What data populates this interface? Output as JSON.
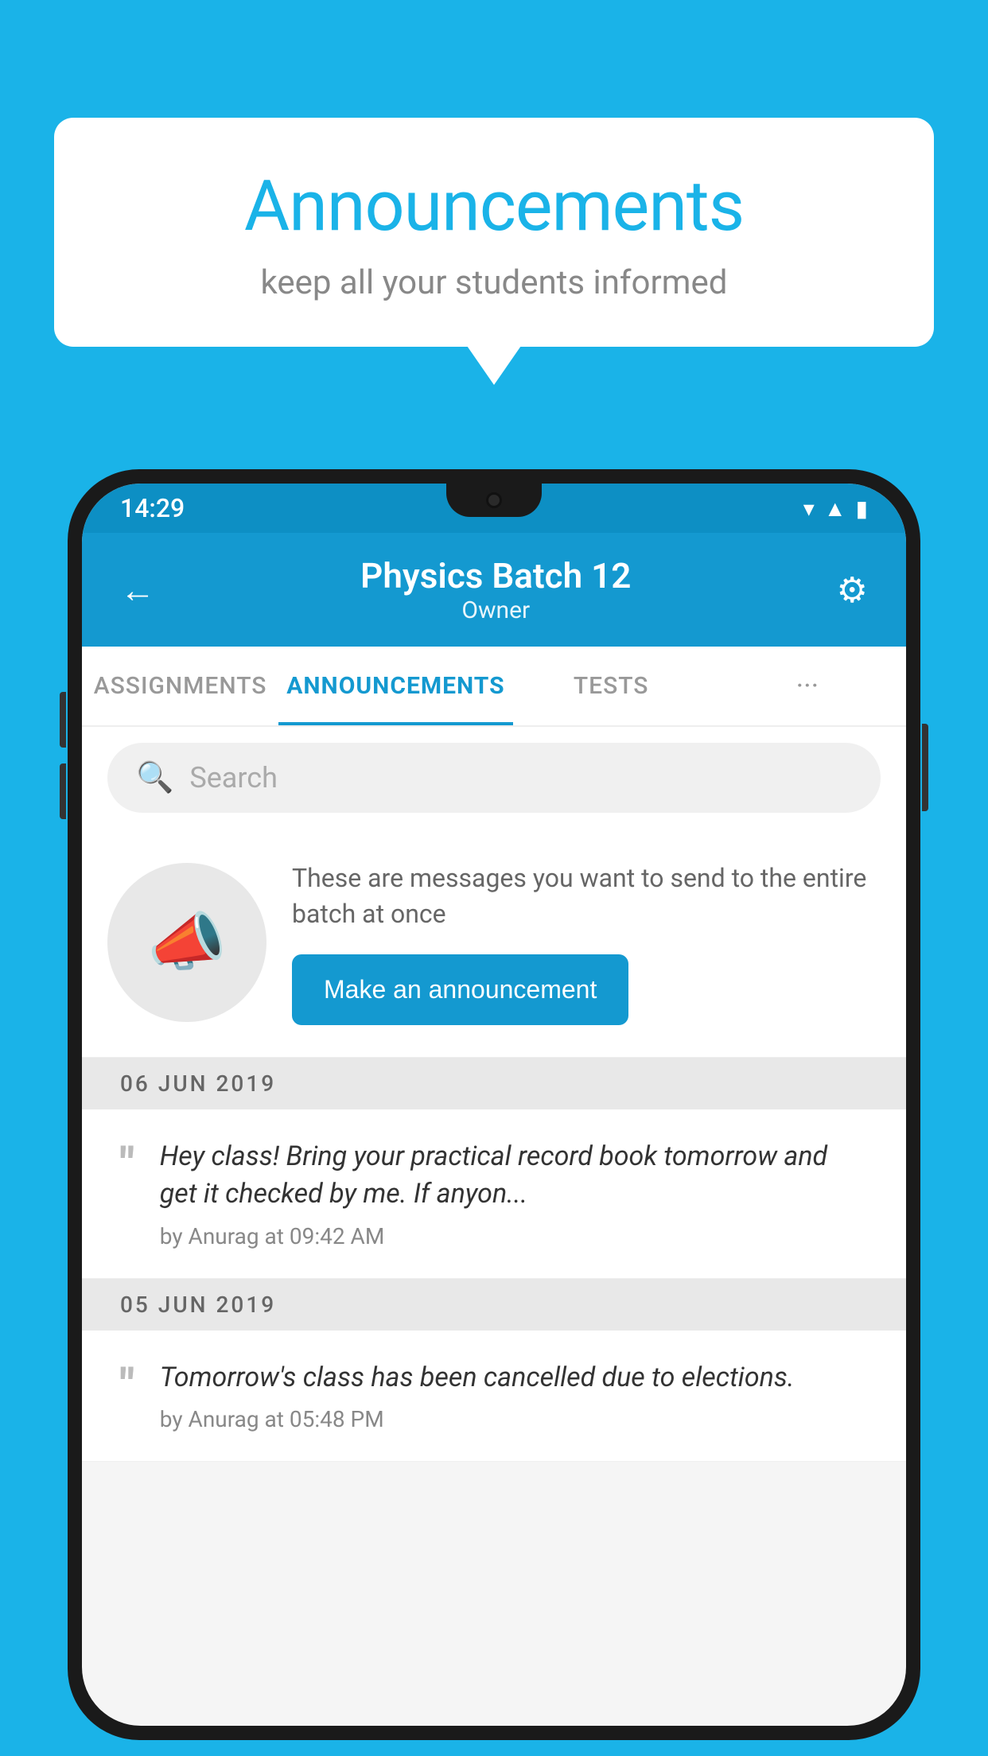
{
  "page": {
    "background_color": "#1ab3e8"
  },
  "speech_bubble": {
    "title": "Announcements",
    "subtitle": "keep all your students informed"
  },
  "status_bar": {
    "time": "14:29",
    "icons": [
      "wifi",
      "signal",
      "battery"
    ]
  },
  "header": {
    "title": "Physics Batch 12",
    "subtitle": "Owner",
    "back_label": "←",
    "settings_label": "⚙"
  },
  "tabs": [
    {
      "label": "ASSIGNMENTS",
      "active": false
    },
    {
      "label": "ANNOUNCEMENTS",
      "active": true
    },
    {
      "label": "TESTS",
      "active": false
    },
    {
      "label": "···",
      "active": false
    }
  ],
  "search": {
    "placeholder": "Search"
  },
  "promo": {
    "description": "These are messages you want to send to the entire batch at once",
    "button_label": "Make an announcement"
  },
  "announcements": [
    {
      "date": "06  JUN  2019",
      "text": "Hey class! Bring your practical record book tomorrow and get it checked by me. If anyon...",
      "meta": "by Anurag at 09:42 AM"
    },
    {
      "date": "05  JUN  2019",
      "text": "Tomorrow's class has been cancelled due to elections.",
      "meta": "by Anurag at 05:48 PM"
    }
  ]
}
